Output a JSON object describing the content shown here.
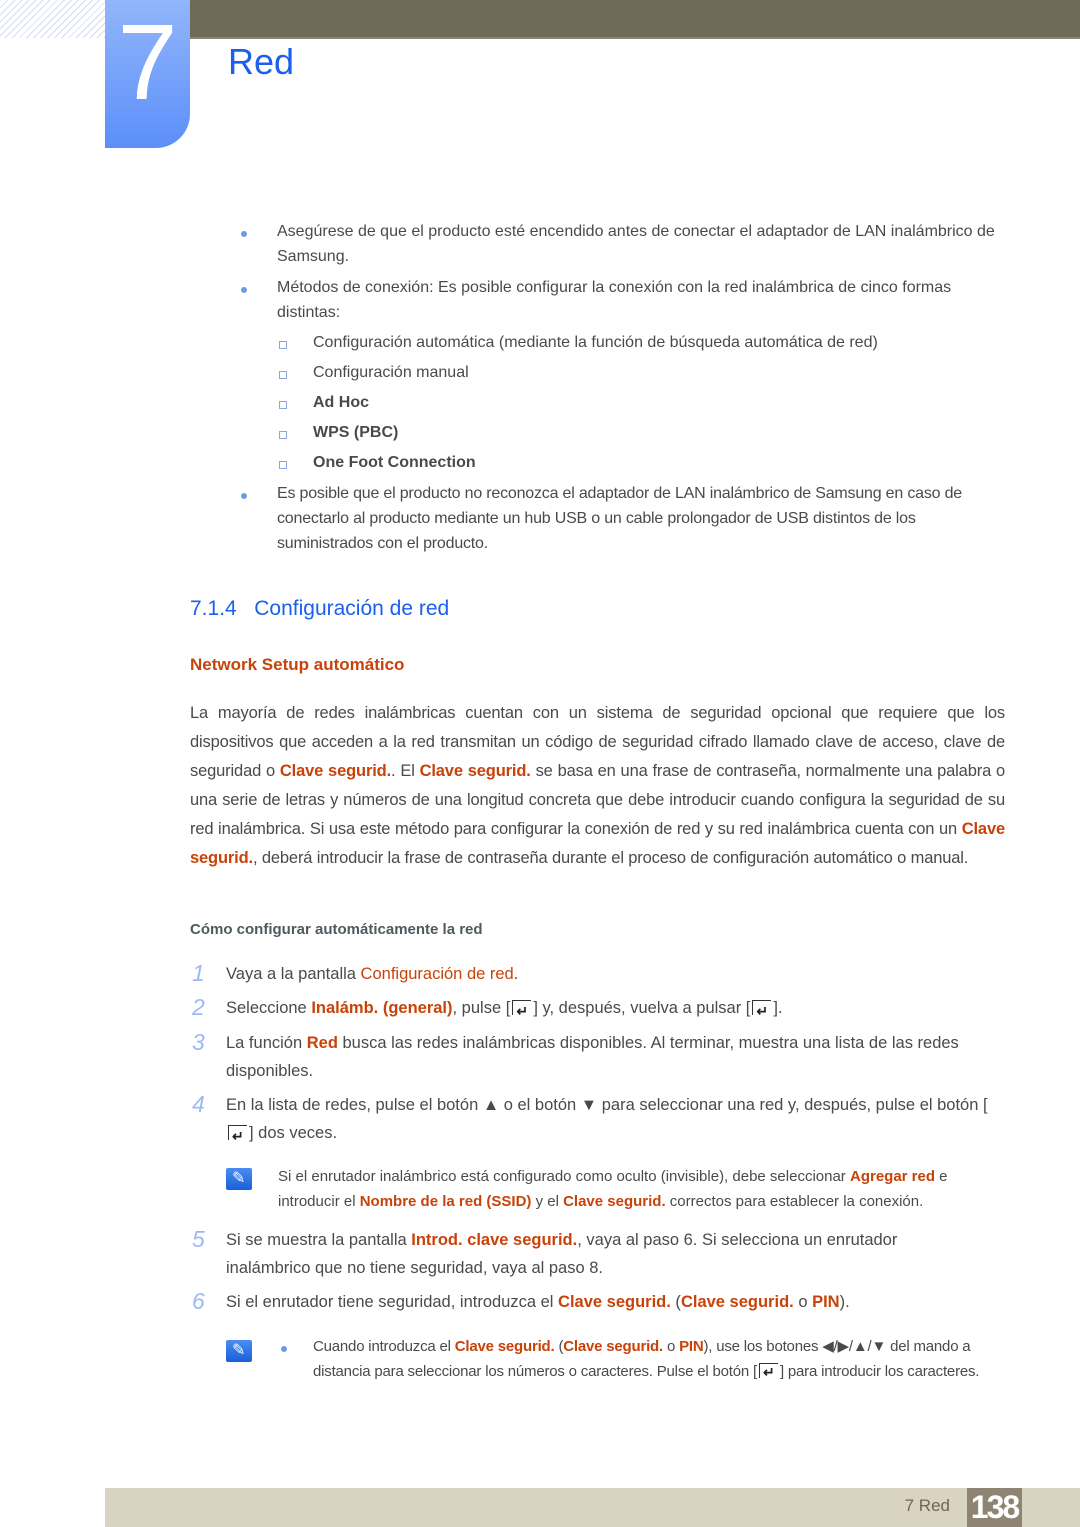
{
  "header": {
    "chapter_number": "7",
    "chapter_title": "Red"
  },
  "intro_bullets": [
    "Asegúrese de que el producto esté encendido antes de conectar el adaptador de LAN inalámbrico de Samsung.",
    "Métodos de conexión: Es posible configurar la conexión con la red inalámbrica de cinco formas distintas:"
  ],
  "methods": [
    {
      "label": "Configuración automática (mediante la función de búsqueda automática de red)",
      "highlight": false
    },
    {
      "label": "Configuración manual",
      "highlight": false
    },
    {
      "label": "Ad Hoc",
      "highlight": true
    },
    {
      "label": "WPS (PBC)",
      "highlight": true
    },
    {
      "label": "One Foot Connection",
      "highlight": true
    }
  ],
  "bullet3": "Es posible que el producto no reconozca el adaptador de LAN inalámbrico de Samsung en caso de conectarlo al producto mediante un hub USB o un cable prolongador de USB distintos de los suministrados con el producto.",
  "section": {
    "number": "7.1.4",
    "title": "Configuración de red"
  },
  "subsection": "Network Setup automático",
  "para": {
    "p1": "La mayoría de redes inalámbricas cuentan con un sistema de seguridad opcional que requiere que los dispositivos que acceden a la red transmitan un código de seguridad cifrado llamado clave de acceso, clave de seguridad o ",
    "k1": "Clave segurid.",
    "p2": ". El ",
    "k2": "Clave segurid.",
    "p3": " se basa en una frase de contraseña, normalmente una palabra o una serie de letras y números de una longitud concreta que debe introducir cuando configura la seguridad de su red inalámbrica. Si usa este método para configurar la conexión de red y su red inalámbrica cuenta con un ",
    "k3": "Clave segurid.",
    "p4": ", deberá introducir la frase de contraseña durante el proceso de configuración automático o manual."
  },
  "howto_title": "Cómo configurar automáticamente la red",
  "steps": {
    "s1": {
      "num": "1",
      "a": "Vaya a la pantalla ",
      "k": "Configuración de red",
      "b": "."
    },
    "s2": {
      "num": "2",
      "a": "Seleccione ",
      "k": "Inalámb. (general)",
      "b": ", pulse [",
      "c": "] y, después, vuelva a pulsar [",
      "d": "]."
    },
    "s3": {
      "num": "3",
      "a": "La función ",
      "k": "Red",
      "b": " busca las redes inalámbricas disponibles. Al terminar, muestra una lista de las redes disponibles."
    },
    "s4": {
      "num": "4",
      "a": "En la lista de redes, pulse el botón ▲ o el botón ▼ para seleccionar una red y, después, pulse el botón [",
      "b": "] dos veces."
    },
    "s5": {
      "num": "5",
      "a": "Si se muestra la pantalla ",
      "k": "Introd. clave segurid.",
      "b": ", vaya al paso 6. Si selecciona un enrutador inalámbrico que no tiene seguridad, vaya al paso 8."
    },
    "s6": {
      "num": "6",
      "a": "Si el enrutador tiene seguridad, introduzca el ",
      "k1": "Clave segurid.",
      "b": " (",
      "k2": "Clave segurid.",
      "c": " o ",
      "k3": "PIN",
      "d": ")."
    }
  },
  "note1": {
    "a": "Si el enrutador inalámbrico está configurado como oculto (invisible), debe seleccionar ",
    "k1": "Agregar red",
    "b": " e introducir el ",
    "k2": "Nombre de la red (SSID)",
    "c": " y el ",
    "k3": "Clave segurid.",
    "d": " correctos para establecer la conexión."
  },
  "note2": {
    "a": "Cuando introduzca el ",
    "k1": "Clave segurid.",
    "b": " (",
    "k2": "Clave segurid.",
    "c": " o ",
    "k3": "PIN",
    "d": "), use los botones ◀/▶/▲/▼ del mando a distancia para seleccionar los números o caracteres. Pulse el botón [",
    "e": "] para introducir los caracteres."
  },
  "footer": {
    "label": "7 Red",
    "page": "138"
  },
  "colors": {
    "accent_blue": "#1a5ff0",
    "highlight_orange": "#c8430a",
    "topbar": "#6e6b58",
    "footer": "#d9d4c1",
    "pagebox": "#8f8474"
  }
}
